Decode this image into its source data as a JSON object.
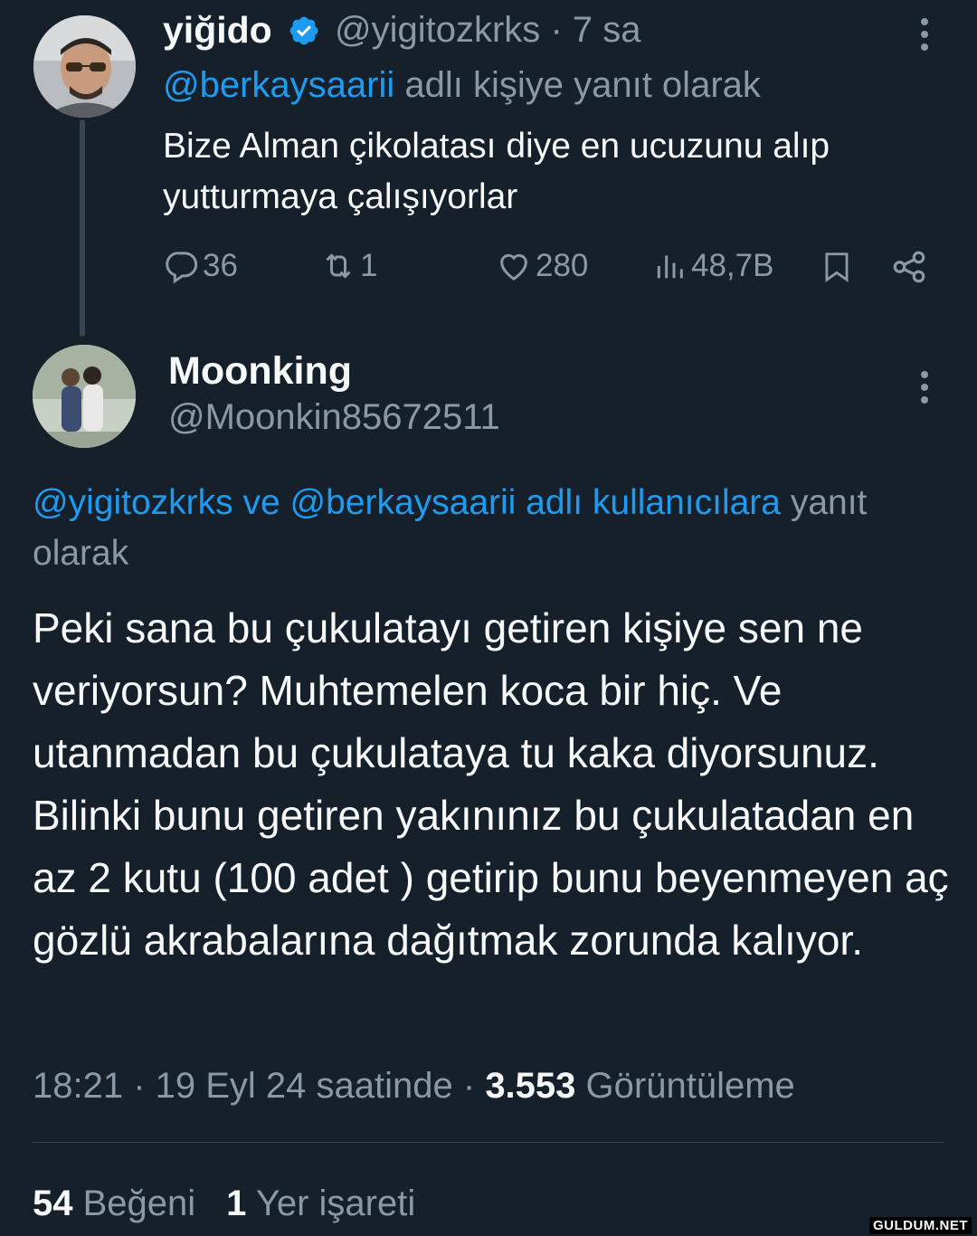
{
  "tweet1": {
    "name": "yiğido",
    "handle": "@yigitozkrks",
    "time": "· 7 sa",
    "reply_mention": "@berkaysaarii",
    "reply_suffix": " adlı kişiye yanıt olarak",
    "text": "Bize Alman çikolatası diye en ucuzunu alıp yutturmaya çalışıyorlar",
    "counts": {
      "replies": "36",
      "reposts": "1",
      "likes": "280",
      "views": "48,7B"
    },
    "icons": [
      "verified-badge-icon",
      "more-icon",
      "reply-icon",
      "repost-icon",
      "like-icon",
      "views-icon",
      "bookmark-icon",
      "share-icon"
    ]
  },
  "tweet2": {
    "name": "Moonking",
    "handle": "@Moonkin85672511",
    "reply_mentions": "@yigitozkrks ve @berkaysaarii adlı kullanıcılara",
    "reply_suffix": " yanıt olarak",
    "text": "Peki sana bu çukulatayı getiren kişiye sen ne veriyorsun? Muhtemelen koca bir hiç. Ve utanmadan bu çukulataya tu kaka diyorsunuz. Bilinki bunu getiren yakınınız bu çukulatadan en az 2 kutu (100 adet ) getirip bunu beyenmeyen aç gözlü akrabalarına dağıtmak zorunda kalıyor.",
    "meta_time": "18:21 · 19 Eyl 24 saatinde · ",
    "meta_views": "3.553",
    "meta_views_label": " Görüntüleme",
    "likes_count": "54",
    "likes_label": " Beğeni",
    "bookmarks_count": "1",
    "bookmarks_label": " Yer işareti"
  },
  "watermark": "GULDUM.NET",
  "colors": {
    "background": "#15202b",
    "accent": "#1d9bf0",
    "muted": "#8b98a5",
    "text": "#f7f9f9"
  }
}
